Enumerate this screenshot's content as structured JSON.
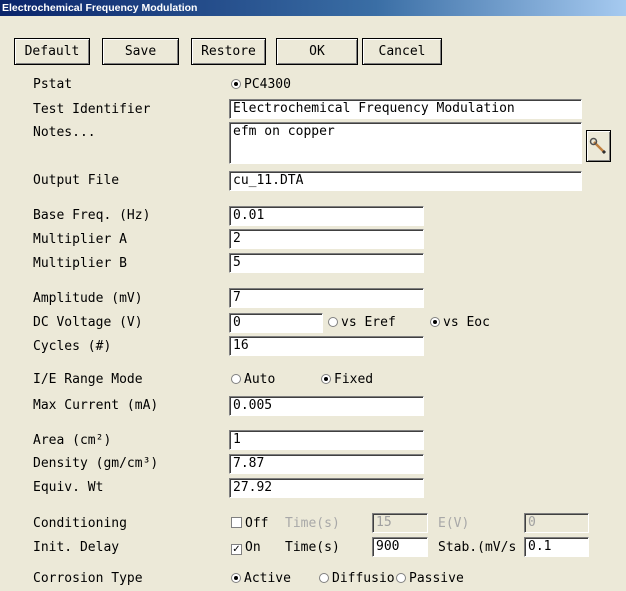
{
  "window": {
    "title": "Electrochemical Frequency Modulation"
  },
  "toolbar": {
    "default_label": "Default",
    "save_label": "Save",
    "restore_label": "Restore",
    "ok_label": "OK",
    "cancel_label": "Cancel"
  },
  "fields": {
    "pstat": {
      "label": "Pstat",
      "option": "PC4300"
    },
    "test_identifier": {
      "label": "Test Identifier",
      "value": "Electrochemical Frequency Modulation"
    },
    "notes": {
      "label": "Notes...",
      "value": "efm on copper"
    },
    "output_file": {
      "label": "Output File",
      "value": "cu_11.DTA"
    },
    "base_freq": {
      "label": "Base Freq. (Hz)",
      "value": "0.01"
    },
    "multiplier_a": {
      "label": "Multiplier A",
      "value": "2"
    },
    "multiplier_b": {
      "label": "Multiplier B",
      "value": "5"
    },
    "amplitude": {
      "label": "Amplitude (mV)",
      "value": "7"
    },
    "dc_voltage": {
      "label": "DC Voltage (V)",
      "value": "0",
      "opt_eref": "vs Eref",
      "opt_eoc": "vs Eoc",
      "selected": "vs Eoc"
    },
    "cycles": {
      "label": "Cycles (#)",
      "value": "16"
    },
    "ie_range_mode": {
      "label": "I/E Range Mode",
      "opt_auto": "Auto",
      "opt_fixed": "Fixed",
      "selected": "Fixed"
    },
    "max_current": {
      "label": "Max Current (mA)",
      "value": "0.005"
    },
    "area": {
      "label": "Area (cm²)",
      "value": "1"
    },
    "density": {
      "label": "Density (gm/cm³)",
      "value": "7.87"
    },
    "equiv_wt": {
      "label": "Equiv. Wt",
      "value": "27.92"
    },
    "conditioning": {
      "label": "Conditioning",
      "check_label": "Off",
      "checked": false,
      "time_label": "Time(s)",
      "time_value": "15",
      "e_label": "E(V)",
      "e_value": "0"
    },
    "init_delay": {
      "label": "Init. Delay",
      "check_label": "On",
      "checked": true,
      "time_label": "Time(s)",
      "time_value": "900",
      "stab_label": "Stab.(mV/s",
      "stab_value": "0.1"
    },
    "corrosion_type": {
      "label": "Corrosion Type",
      "opt_active": "Active",
      "opt_diffusion": "Diffusio",
      "opt_passive": "Passive",
      "selected": "Active"
    }
  }
}
